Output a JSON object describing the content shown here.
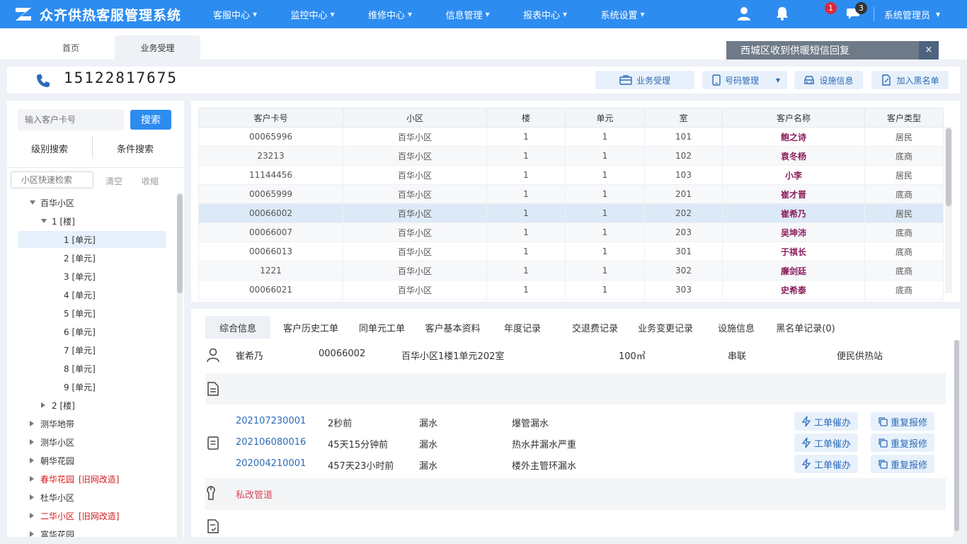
{
  "app": {
    "title": "众齐供热客服管理系统"
  },
  "nav": [
    {
      "label": "客服中心"
    },
    {
      "label": "监控中心"
    },
    {
      "label": "维修中心"
    },
    {
      "label": "信息管理"
    },
    {
      "label": "报表中心"
    },
    {
      "label": "系统设置"
    }
  ],
  "topbar": {
    "badge_alert": "1",
    "badge_msg": "3",
    "user": "系统管理员"
  },
  "tabs": [
    {
      "label": "首页"
    },
    {
      "label": "业务受理"
    }
  ],
  "notice": {
    "text": "西城区收到供暖短信回复",
    "close": "×"
  },
  "phone": {
    "number": "15122817675"
  },
  "actions": [
    {
      "label": "业务受理"
    },
    {
      "label": "号码管理"
    },
    {
      "label": "设施信息"
    },
    {
      "label": "加入黑名单"
    }
  ],
  "search": {
    "card_placeholder": "输入客户卡号",
    "button": "搜索",
    "tab_level": "级别搜索",
    "tab_condition": "条件搜索",
    "quick_placeholder": "小区快速检索",
    "clear": "清空",
    "collapse": "收缩"
  },
  "tree": [
    {
      "label": "百华小区",
      "tag": "",
      "depth": 0,
      "exp": "open"
    },
    {
      "label": "1 [楼]",
      "tag": "",
      "depth": 1,
      "exp": "open"
    },
    {
      "label": "1 [单元]",
      "tag": "",
      "depth": 2,
      "exp": "",
      "selected": true
    },
    {
      "label": "2 [单元]",
      "tag": "",
      "depth": 2,
      "exp": ""
    },
    {
      "label": "3 [单元]",
      "tag": "",
      "depth": 2,
      "exp": ""
    },
    {
      "label": "4 [单元]",
      "tag": "",
      "depth": 2,
      "exp": ""
    },
    {
      "label": "5 [单元]",
      "tag": "",
      "depth": 2,
      "exp": ""
    },
    {
      "label": "6 [单元]",
      "tag": "",
      "depth": 2,
      "exp": ""
    },
    {
      "label": "7 [单元]",
      "tag": "",
      "depth": 2,
      "exp": ""
    },
    {
      "label": "8 [单元]",
      "tag": "",
      "depth": 2,
      "exp": ""
    },
    {
      "label": "9 [单元]",
      "tag": "",
      "depth": 2,
      "exp": ""
    },
    {
      "label": "2 [楼]",
      "tag": "",
      "depth": 1,
      "exp": "closed"
    },
    {
      "label": "测华地带",
      "tag": "",
      "depth": 0,
      "exp": "closed"
    },
    {
      "label": "测华小区",
      "tag": "",
      "depth": 0,
      "exp": "closed"
    },
    {
      "label": "朝华花园",
      "tag": "",
      "depth": 0,
      "exp": "closed"
    },
    {
      "label": "春华花园",
      "tag": "[旧网改造]",
      "depth": 0,
      "exp": "closed",
      "red": true
    },
    {
      "label": "杜华小区",
      "tag": "",
      "depth": 0,
      "exp": "closed"
    },
    {
      "label": "二华小区",
      "tag": "[旧网改造]",
      "depth": 0,
      "exp": "closed",
      "red": true
    },
    {
      "label": "富华花园",
      "tag": "",
      "depth": 0,
      "exp": "closed"
    }
  ],
  "table": {
    "headers": [
      "客户卡号",
      "小区",
      "楼",
      "单元",
      "室",
      "客户名称",
      "客户类型"
    ],
    "rows": [
      [
        "00065996",
        "百华小区",
        "1",
        "1",
        "101",
        "鲍之诗",
        "居民"
      ],
      [
        "23213",
        "百华小区",
        "1",
        "1",
        "102",
        "袁冬杨",
        "底商"
      ],
      [
        "11144456",
        "百华小区",
        "1",
        "1",
        "103",
        "小李",
        "居民"
      ],
      [
        "00065999",
        "百华小区",
        "1",
        "1",
        "201",
        "崔才晋",
        "底商"
      ],
      [
        "00066002",
        "百华小区",
        "1",
        "1",
        "202",
        "崔希乃",
        "居民"
      ],
      [
        "00066007",
        "百华小区",
        "1",
        "1",
        "203",
        "吴坤沛",
        "底商"
      ],
      [
        "00066013",
        "百华小区",
        "1",
        "1",
        "301",
        "于祺长",
        "底商"
      ],
      [
        "1221",
        "百华小区",
        "1",
        "1",
        "302",
        "廉剑廷",
        "底商"
      ],
      [
        "00066021",
        "百华小区",
        "1",
        "1",
        "303",
        "史希泰",
        "底商"
      ]
    ],
    "selected_index": 4
  },
  "detail_tabs": [
    {
      "label": "综合信息"
    },
    {
      "label": "客户历史工单"
    },
    {
      "label": "同单元工单"
    },
    {
      "label": "客户基本资料"
    },
    {
      "label": "年度记录"
    },
    {
      "label": "交退费记录"
    },
    {
      "label": "业务变更记录"
    },
    {
      "label": "设施信息"
    },
    {
      "label": "黑名单记录(0)"
    }
  ],
  "customer": {
    "name": "崔希乃",
    "card": "00066002",
    "address": "百华小区1楼1单元202室",
    "area": "100㎡",
    "connection": "串联",
    "station": "便民供热站"
  },
  "work_orders": [
    {
      "id": "202107230001",
      "ago": "2秒前",
      "type": "漏水",
      "desc": "爆管漏水",
      "urge": "工单催办",
      "repeat": "重复报修"
    },
    {
      "id": "202106080016",
      "ago": "45天15分钟前",
      "type": "漏水",
      "desc": "热水井漏水严重",
      "urge": "工单催办",
      "repeat": "重复报修"
    },
    {
      "id": "202004210001",
      "ago": "457天23小时前",
      "type": "漏水",
      "desc": "楼外主管环漏水",
      "urge": "工单催办",
      "repeat": "重复报修"
    }
  ],
  "facility_note": "私改管道",
  "colors": {
    "primary": "#2d8cf0",
    "name_text": "#8a1d5c",
    "alert_red": "#d41c1c",
    "badge_red": "#e0283a"
  }
}
